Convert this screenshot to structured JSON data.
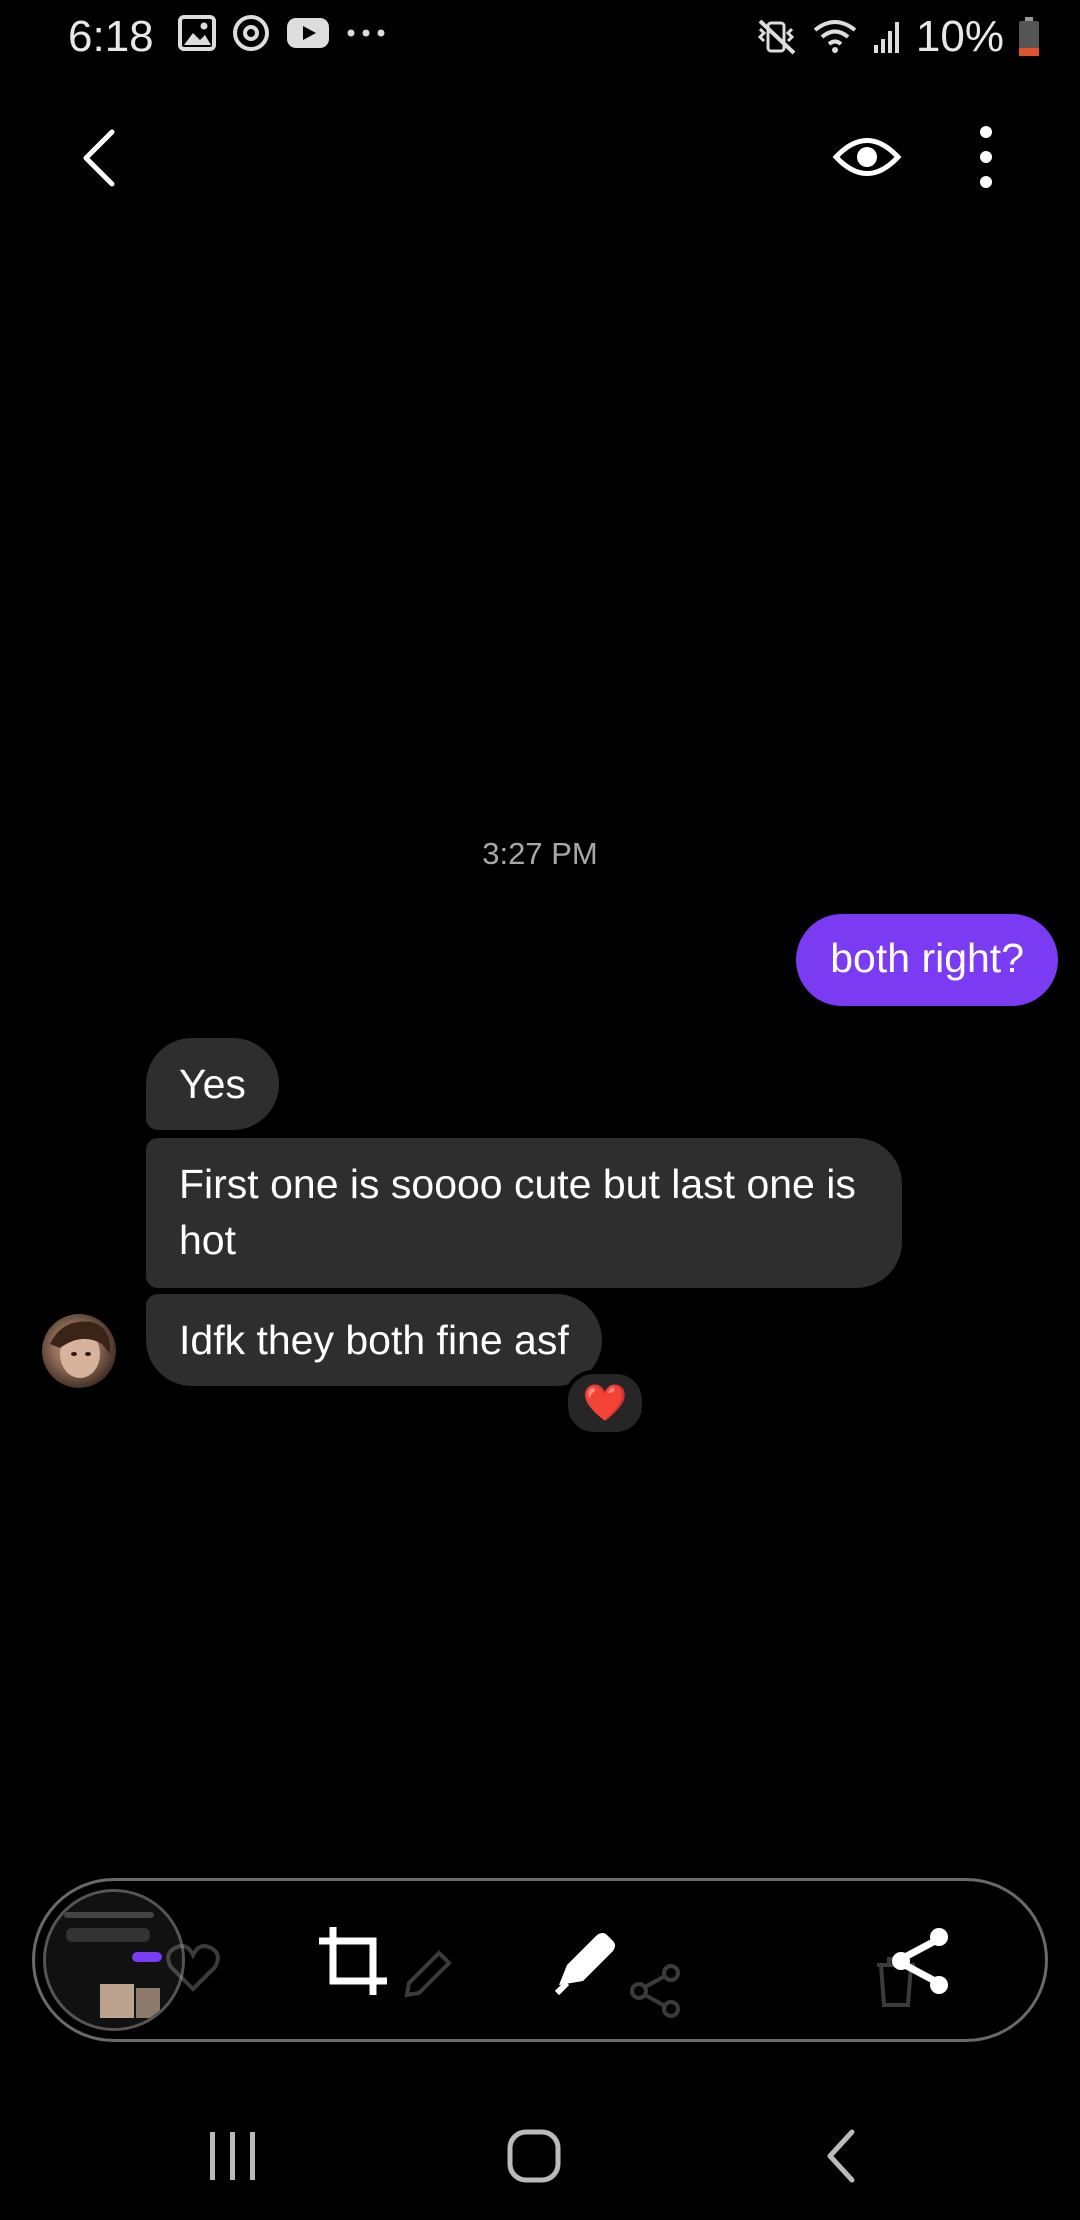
{
  "status_bar": {
    "time": "6:18",
    "battery": "10%",
    "left_icons": [
      "gallery-icon",
      "at-icon",
      "youtube-icon",
      "more-dots-icon"
    ],
    "right_icons": [
      "mute-vibrate-icon",
      "wifi-icon",
      "signal-icon",
      "battery-icon"
    ]
  },
  "header": {
    "icons": [
      "back-icon",
      "eye-icon",
      "more-vertical-icon"
    ]
  },
  "conversation": {
    "timestamp": "3:27 PM",
    "sent": [
      {
        "text": "both right?"
      }
    ],
    "received": [
      {
        "text": "Yes"
      },
      {
        "text": "First one is soooo cute but last one is hot"
      },
      {
        "text": "Idfk they both fine asf"
      }
    ],
    "reaction": "❤️"
  },
  "toolbar": {
    "tools": [
      "crop-icon",
      "pen-icon",
      "share-icon"
    ],
    "background_ghost_icons": [
      "heart-icon",
      "pencil-icon",
      "share-icon",
      "trash-icon"
    ]
  },
  "nav_bar": {
    "buttons": [
      "recents-icon",
      "home-icon",
      "back-icon"
    ]
  },
  "colors": {
    "background": "#000000",
    "sent_bubble": "#7b3bf2",
    "received_bubble": "#2e2e2e",
    "battery_low": "#e0522c"
  }
}
